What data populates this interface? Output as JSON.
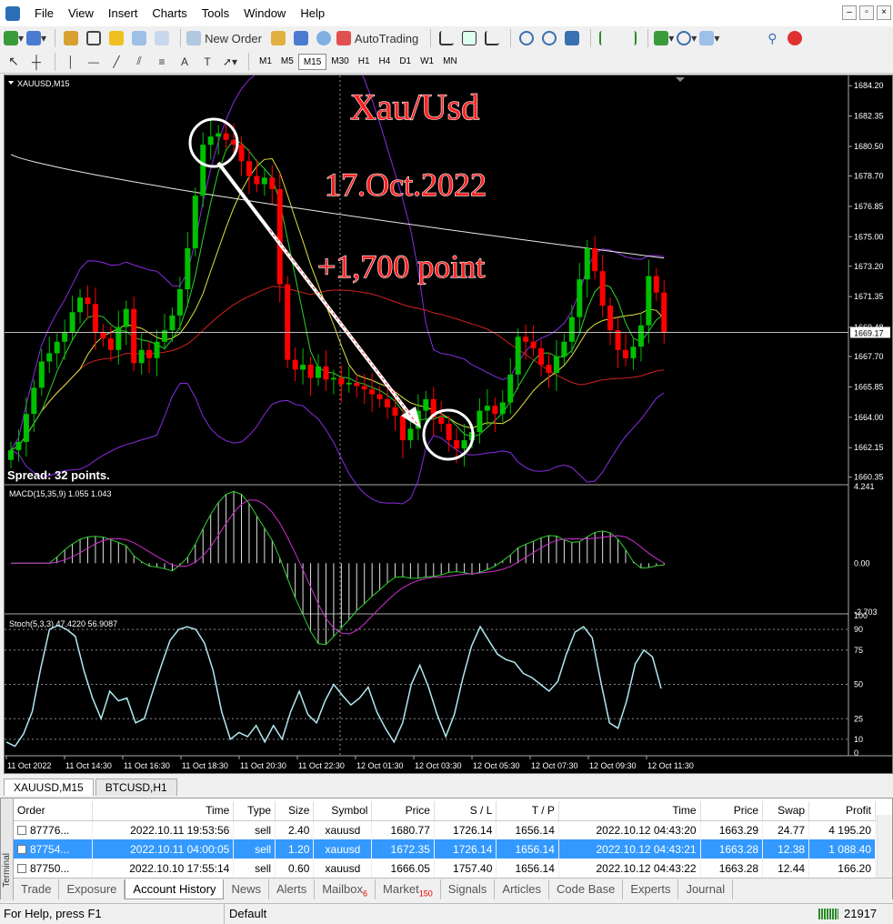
{
  "menu": [
    "File",
    "View",
    "Insert",
    "Charts",
    "Tools",
    "Window",
    "Help"
  ],
  "toolbar": {
    "new_order": "New Order",
    "autotrading": "AutoTrading"
  },
  "timeframes": [
    "M1",
    "M5",
    "M15",
    "M30",
    "H1",
    "H4",
    "D1",
    "W1",
    "MN"
  ],
  "active_timeframe": "M15",
  "chart": {
    "symbol_label": "XAUUSD,M15",
    "annotation_title": "Xau/Usd",
    "annotation_date": "17.Oct.2022",
    "annotation_points": "+1,700 point",
    "spread": "Spread: 32 points.",
    "current_price": "1669.17",
    "partial_price": "1669.48",
    "macd_label": "MACD(15,35,9) 1.055 1.043",
    "stoch_label": "Stoch(5,3,3) 47.4220 56.9087",
    "colors": {
      "bull": "#00c000",
      "bear": "#ff0000",
      "background": "#000000",
      "annotation": "#ff2020"
    }
  },
  "chart_data": [
    {
      "type": "candlestick",
      "title": "XAUUSD,M15",
      "y_ticks": [
        "1684.20",
        "1682.35",
        "1680.50",
        "1678.70",
        "1676.85",
        "1675.00",
        "1673.20",
        "1671.35",
        "1669.48",
        "1667.70",
        "1665.85",
        "1664.00",
        "1662.15",
        "1660.35"
      ],
      "x_ticks": [
        "11 Oct 2022",
        "11 Oct 14:30",
        "11 Oct 16:30",
        "11 Oct 18:30",
        "11 Oct 20:30",
        "11 Oct 22:30",
        "12 Oct 01:30",
        "12 Oct 03:30",
        "12 Oct 05:30",
        "12 Oct 07:30",
        "12 Oct 09:30",
        "12 Oct 11:30"
      ],
      "ylim": [
        1660.0,
        1684.6
      ],
      "close": [
        1662.0,
        1662.5,
        1664.2,
        1665.8,
        1667.4,
        1667.9,
        1668.6,
        1669.2,
        1670.4,
        1671.3,
        1670.9,
        1669.2,
        1668.8,
        1668.1,
        1669.5,
        1670.6,
        1667.3,
        1668.1,
        1667.6,
        1668.6,
        1669.3,
        1670.2,
        1671.8,
        1674.3,
        1677.5,
        1680.6,
        1681.1,
        1681.3,
        1680.9,
        1680.6,
        1679.6,
        1678.7,
        1678.2,
        1678.6,
        1677.9,
        1672.1,
        1667.5,
        1666.9,
        1667.2,
        1666.4,
        1667.1,
        1666.3,
        1666.4,
        1666.0,
        1666.1,
        1665.9,
        1665.7,
        1665.4,
        1665.1,
        1664.6,
        1664.1,
        1662.6,
        1663.3,
        1664.4,
        1665.1,
        1664.0,
        1663.6,
        1662.6,
        1662.1,
        1662.6,
        1663.1,
        1664.4,
        1664.7,
        1664.2,
        1664.9,
        1666.6,
        1668.9,
        1668.6,
        1668.2,
        1667.2,
        1666.7,
        1667.7,
        1668.6,
        1670.1,
        1672.4,
        1674.3,
        1672.9,
        1670.8,
        1669.3,
        1668.1,
        1667.6,
        1668.3,
        1669.6,
        1672.6,
        1671.6,
        1669.2
      ],
      "ma_white": "slow descending moving average from 1680.0 to 1673.7",
      "series": [
        {
          "name": "XAUUSD,M15"
        }
      ]
    },
    {
      "type": "histogram",
      "title": "MACD(15,35,9) 1.055 1.043",
      "y_ticks": [
        "4.241",
        "0.00",
        "-2.703"
      ],
      "ylim": [
        -2.703,
        4.241
      ]
    },
    {
      "type": "line",
      "title": "Stoch(5,3,3) 47.4220 56.9087",
      "y_ticks": [
        "100",
        "90",
        "75",
        "50",
        "25",
        "10",
        "0"
      ],
      "ylim": [
        0,
        100
      ],
      "values": [
        8,
        5,
        14,
        30,
        62,
        90,
        93,
        90,
        85,
        60,
        40,
        25,
        45,
        38,
        40,
        22,
        25,
        45,
        64,
        82,
        90,
        92,
        90,
        80,
        60,
        30,
        10,
        15,
        12,
        20,
        8,
        20,
        10,
        30,
        45,
        28,
        22,
        38,
        50,
        42,
        35,
        40,
        48,
        30,
        18,
        8,
        22,
        50,
        64,
        48,
        28,
        12,
        28,
        55,
        78,
        92,
        82,
        72,
        68,
        66,
        58,
        55,
        50,
        45,
        52,
        72,
        88,
        92,
        84,
        52,
        22,
        18,
        38,
        65,
        75,
        70,
        47
      ]
    }
  ],
  "chart_tabs": [
    "XAUUSD,M15",
    "BTCUSD,H1"
  ],
  "terminal": {
    "side_label": "Terminal",
    "columns": [
      "Order",
      "Time",
      "Type",
      "Size",
      "Symbol",
      "Price",
      "S / L",
      "T / P",
      "Time",
      "Price",
      "Swap",
      "Profit"
    ],
    "rows": [
      [
        "87776...",
        "2022.10.11 19:53:56",
        "sell",
        "2.40",
        "xauusd",
        "1680.77",
        "1726.14",
        "1656.14",
        "2022.10.12 04:43:20",
        "1663.29",
        "24.77",
        "4 195.20"
      ],
      [
        "87754...",
        "2022.10.11 04:00:05",
        "sell",
        "1.20",
        "xauusd",
        "1672.35",
        "1726.14",
        "1656.14",
        "2022.10.12 04:43:21",
        "1663.28",
        "12.38",
        "1 088.40"
      ],
      [
        "87750...",
        "2022.10.10 17:55:14",
        "sell",
        "0.60",
        "xauusd",
        "1666.05",
        "1757.40",
        "1656.14",
        "2022.10.12 04:43:22",
        "1663.28",
        "12.44",
        "166.20"
      ]
    ],
    "selected_row": 1,
    "tabs": [
      {
        "label": "Trade",
        "badge": ""
      },
      {
        "label": "Exposure",
        "badge": ""
      },
      {
        "label": "Account History",
        "badge": ""
      },
      {
        "label": "News",
        "badge": ""
      },
      {
        "label": "Alerts",
        "badge": ""
      },
      {
        "label": "Mailbox",
        "badge": "6"
      },
      {
        "label": "Market",
        "badge": "150"
      },
      {
        "label": "Signals",
        "badge": ""
      },
      {
        "label": "Articles",
        "badge": ""
      },
      {
        "label": "Code Base",
        "badge": ""
      },
      {
        "label": "Experts",
        "badge": ""
      },
      {
        "label": "Journal",
        "badge": ""
      }
    ],
    "active_tab": 2
  },
  "status": {
    "help": "For Help, press F1",
    "profile": "Default",
    "traffic": "21917"
  }
}
